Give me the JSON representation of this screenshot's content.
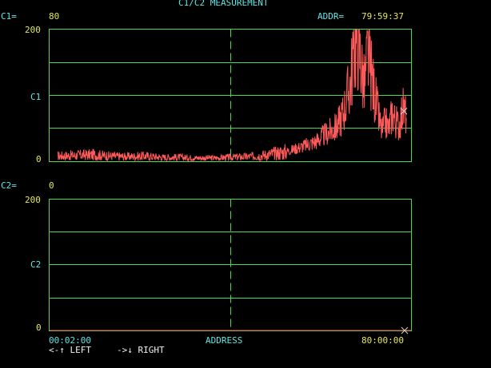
{
  "title": "C1/C2 MEASUREMENT",
  "c1": {
    "label": "C1=",
    "value": "80"
  },
  "addr": {
    "label": "ADDR=",
    "value": "79:59:37"
  },
  "c2": {
    "label": "C2=",
    "value": "0"
  },
  "top_chart": {
    "ymax_label": "200",
    "ymid_label": "C1",
    "ymin_label": "0"
  },
  "bottom_chart": {
    "ymax_label": "200",
    "ymid_label": "C2",
    "ymin_label": "0"
  },
  "x_axis": {
    "start": "00:02:00",
    "center": "ADDRESS",
    "end": "80:00:00"
  },
  "nav": {
    "left_hint": "<-↑ LEFT",
    "right_hint": "->↓ RIGHT"
  },
  "colors": {
    "grid": "#4fd84f",
    "trace": "#ff5a5a",
    "label_cyan": "#5ee6e6",
    "label_yellow": "#e6e65a",
    "cursor": "#d0d0d0"
  },
  "chart_data": [
    {
      "type": "line",
      "ylabel": "C1",
      "ylim": [
        0,
        200
      ],
      "x_range": [
        "00:02:00",
        "80:00:00"
      ],
      "series": [
        {
          "x_fraction": [
            0.0,
            0.05,
            0.1,
            0.15,
            0.2,
            0.25,
            0.3,
            0.35,
            0.4,
            0.45,
            0.5,
            0.55,
            0.6,
            0.65,
            0.7,
            0.72,
            0.74,
            0.76,
            0.78,
            0.8,
            0.82,
            0.84,
            0.85,
            0.86,
            0.87,
            0.88,
            0.89,
            0.9,
            0.91,
            0.92,
            0.93,
            0.94,
            0.95,
            0.96,
            0.97,
            0.98,
            0.99,
            1.0
          ],
          "values": [
            8,
            9,
            10,
            8,
            7,
            8,
            6,
            6,
            5,
            5,
            6,
            7,
            10,
            14,
            22,
            26,
            30,
            38,
            45,
            52,
            75,
            120,
            175,
            195,
            150,
            110,
            165,
            130,
            100,
            70,
            45,
            60,
            50,
            75,
            60,
            55,
            80,
            70
          ]
        }
      ]
    },
    {
      "type": "line",
      "ylabel": "C2",
      "ylim": [
        0,
        200
      ],
      "x_range": [
        "00:02:00",
        "80:00:00"
      ],
      "series": [
        {
          "x_fraction": [
            0,
            1
          ],
          "values": [
            0,
            0
          ]
        }
      ]
    }
  ]
}
